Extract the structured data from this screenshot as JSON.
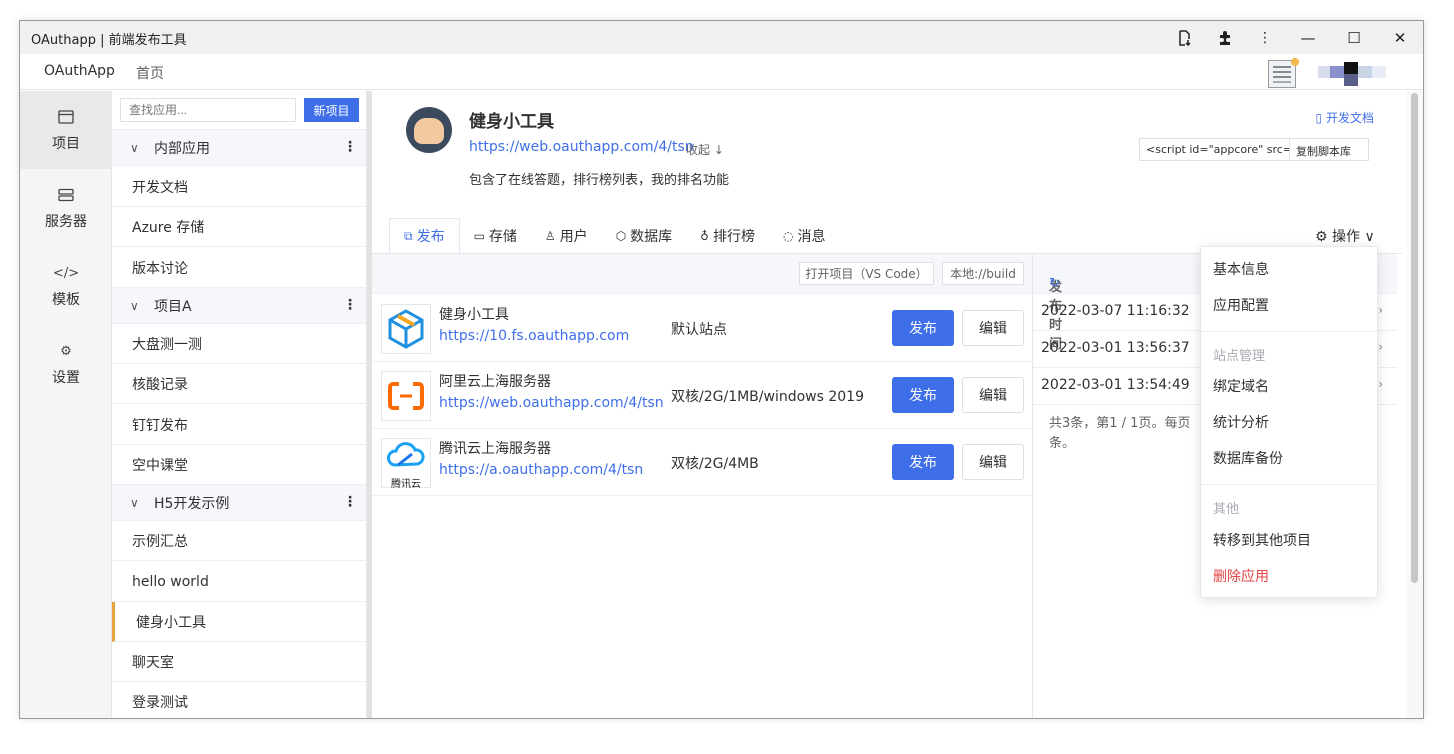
{
  "window": {
    "title": "OAuthapp | 前端发布工具"
  },
  "menubar": {
    "brand": "OAuthApp",
    "home": "首页"
  },
  "left_nav": [
    {
      "label": "项目",
      "icon": "window-icon"
    },
    {
      "label": "服务器",
      "icon": "server-icon"
    },
    {
      "label": "模板",
      "icon": "code-icon"
    },
    {
      "label": "设置",
      "icon": "gear-icon"
    }
  ],
  "app_list": {
    "search_placeholder": "查找应用...",
    "new_button": "新项目",
    "groups": [
      {
        "name": "内部应用",
        "items": [
          "开发文档",
          "Azure 存储",
          "版本讨论"
        ]
      },
      {
        "name": "项目A",
        "items": [
          "大盘测一测",
          "核酸记录",
          "钉钉发布",
          "空中课堂"
        ]
      },
      {
        "name": "H5开发示例",
        "items": [
          "示例汇总",
          "hello world",
          "健身小工具",
          "聊天室",
          "登录测试"
        ]
      }
    ],
    "selected": "健身小工具"
  },
  "app": {
    "name": "健身小工具",
    "url": "https://web.oauthapp.com/4/tsn",
    "collapse": "收起",
    "description": "包含了在线答题，排行榜列表，我的排名功能",
    "dev_doc": "开发文档",
    "script_code": "<script id=\"appcore\" src=",
    "copy_script": "复制脚本库"
  },
  "tabs": [
    {
      "label": "发布",
      "icon": "external-link-icon"
    },
    {
      "label": "存储",
      "icon": "folder-icon"
    },
    {
      "label": "用户",
      "icon": "user-icon"
    },
    {
      "label": "数据库",
      "icon": "cube-icon"
    },
    {
      "label": "排行榜",
      "icon": "medal-icon"
    },
    {
      "label": "消息",
      "icon": "chat-icon"
    }
  ],
  "operations": "操作",
  "toolbar": {
    "open_project": "打开项目（VS Code）",
    "local_build": "本地://build"
  },
  "sites": [
    {
      "name": "健身小工具",
      "url": "https://10.fs.oauthapp.com",
      "spec": "默认站点",
      "publish": "发布",
      "edit": "编辑",
      "icon": "box-icon"
    },
    {
      "name": "阿里云上海服务器",
      "url": "https://web.oauthapp.com/4/tsn",
      "spec": "双核/2G/1MB/windows 2019",
      "publish": "发布",
      "edit": "编辑",
      "icon": "aliyun-icon"
    },
    {
      "name": "腾讯云上海服务器",
      "url": "https://a.oauthapp.com/4/tsn",
      "spec": "双核/2G/4MB",
      "publish": "发布",
      "edit": "编辑",
      "icon": "tencent-cloud-icon",
      "icon_label": "腾讯云"
    }
  ],
  "history": {
    "header": "发布时间",
    "rows": [
      "2022-03-07 11:16:32",
      "2022-03-01 13:56:37",
      "2022-03-01 13:54:49"
    ],
    "footer": "共3条，第1 / 1页。每页 条。"
  },
  "dropdown": {
    "items_top": [
      "基本信息",
      "应用配置"
    ],
    "group1": "站点管理",
    "items_mid": [
      "绑定域名",
      "统计分析",
      "数据库备份"
    ],
    "group2": "其他",
    "items_bottom": [
      "转移到其他项目",
      "删除应用"
    ],
    "danger_color": "#e64545"
  },
  "colors": {
    "primary": "#3f6fe8",
    "accent_selected": "#e6a23c"
  }
}
